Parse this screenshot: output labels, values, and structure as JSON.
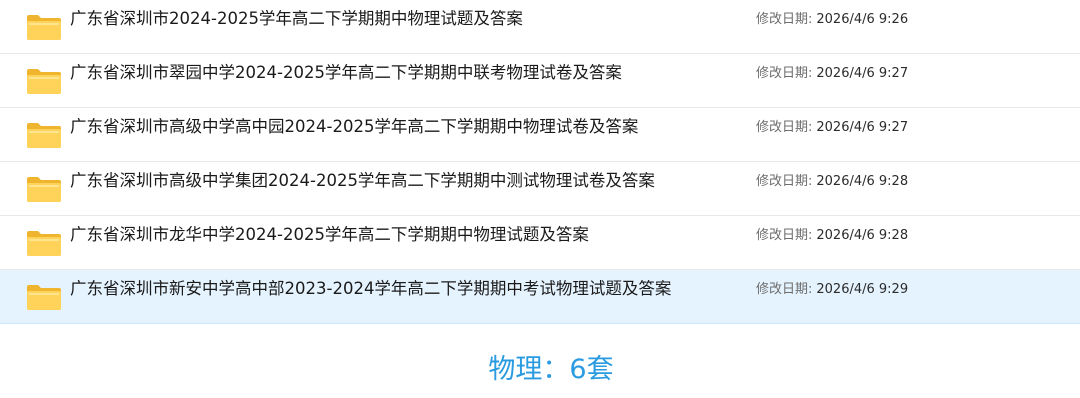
{
  "date_label": "修改日期:",
  "files": [
    {
      "name": "广东省深圳市2024-2025学年高二下学期期中物理试题及答案",
      "date": "2026/4/6 9:26",
      "icon": "folder-icon"
    },
    {
      "name": "广东省深圳市翠园中学2024-2025学年高二下学期期中联考物理试卷及答案",
      "date": "2026/4/6 9:27",
      "icon": "folder-icon"
    },
    {
      "name": "广东省深圳市高级中学高中园2024-2025学年高二下学期期中物理试卷及答案",
      "date": "2026/4/6 9:27",
      "icon": "folder-icon"
    },
    {
      "name": "广东省深圳市高级中学集团2024-2025学年高二下学期期中测试物理试卷及答案",
      "date": "2026/4/6 9:28",
      "icon": "folder-icon"
    },
    {
      "name": "广东省深圳市龙华中学2024-2025学年高二下学期期中物理试题及答案",
      "date": "2026/4/6 9:28",
      "icon": "folder-icon"
    },
    {
      "name": "广东省深圳市新安中学高中部2023-2024学年高二下学期期中考试物理试题及答案",
      "date": "2026/4/6 9:29",
      "icon": "folder-icon",
      "selected": true
    }
  ],
  "summary": "物理：6套",
  "colors": {
    "selected_row": "#e5f3ff",
    "summary_text": "#2a9be0",
    "folder_body": "#ffd35a",
    "folder_back": "#f0b52e"
  }
}
